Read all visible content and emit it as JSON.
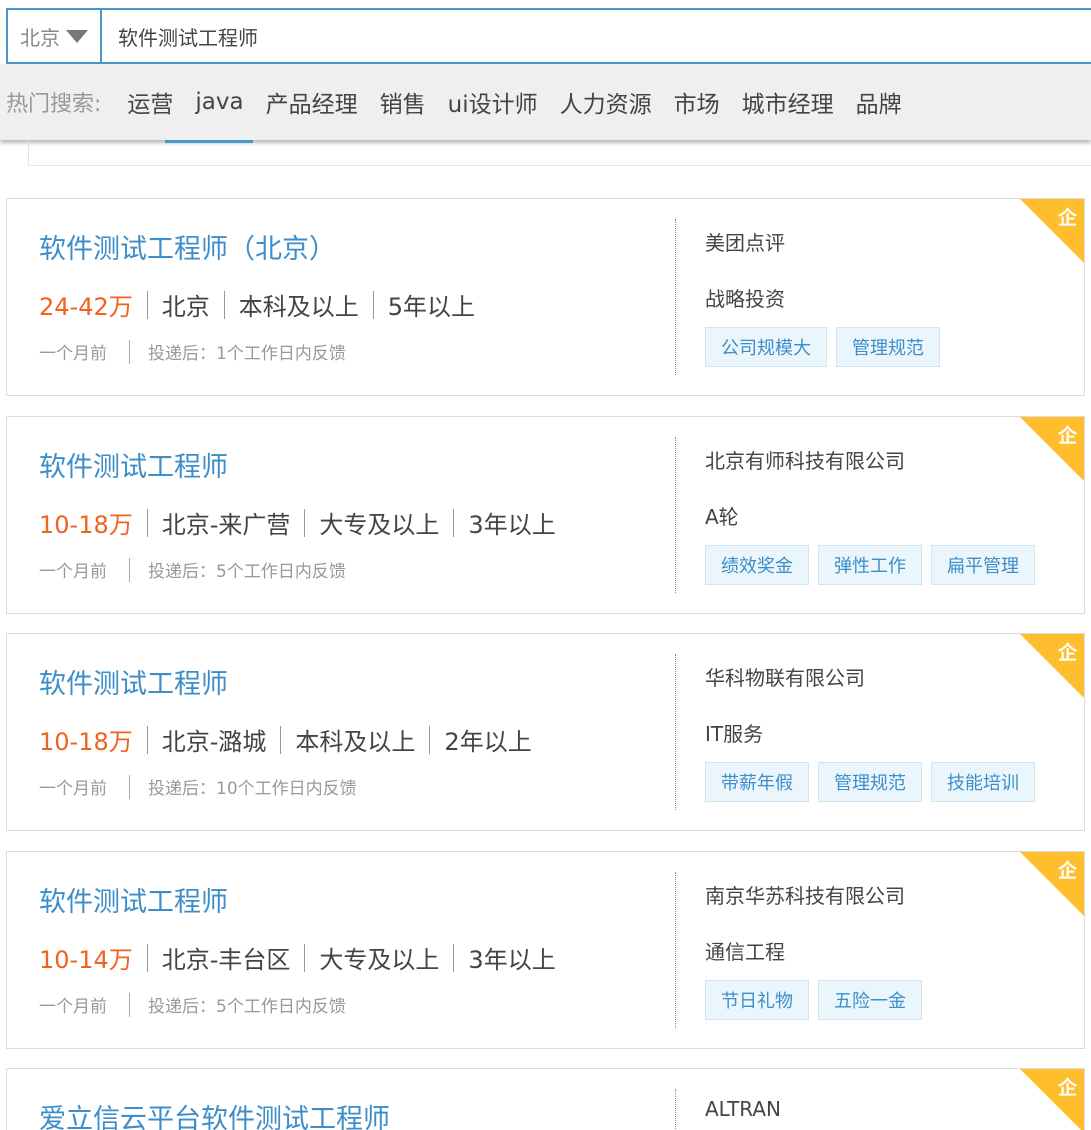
{
  "search": {
    "city": "北京",
    "query": "软件测试工程师"
  },
  "hot_search": {
    "label": "热门搜索:",
    "items": [
      "运营",
      "java",
      "产品经理",
      "销售",
      "ui设计师",
      "人力资源",
      "市场",
      "城市经理",
      "品牌"
    ]
  },
  "jobs": [
    {
      "title": "软件测试工程师（北京）",
      "salary": "24-42万",
      "location": "北京",
      "education": "本科及以上",
      "experience": "5年以上",
      "posted": "一个月前",
      "feedback": "投递后：1个工作日内反馈",
      "company": "美团点评",
      "industry": "战略投资",
      "tags": [
        "公司规模大",
        "管理规范"
      ],
      "badge": "企"
    },
    {
      "title": "软件测试工程师",
      "salary": "10-18万",
      "location": "北京-来广营",
      "education": "大专及以上",
      "experience": "3年以上",
      "posted": "一个月前",
      "feedback": "投递后：5个工作日内反馈",
      "company": "北京有师科技有限公司",
      "industry": "A轮",
      "tags": [
        "绩效奖金",
        "弹性工作",
        "扁平管理"
      ],
      "badge": "企"
    },
    {
      "title": "软件测试工程师",
      "salary": "10-18万",
      "location": "北京-潞城",
      "education": "本科及以上",
      "experience": "2年以上",
      "posted": "一个月前",
      "feedback": "投递后：10个工作日内反馈",
      "company": "华科物联有限公司",
      "industry": "IT服务",
      "tags": [
        "带薪年假",
        "管理规范",
        "技能培训"
      ],
      "badge": "企"
    },
    {
      "title": "软件测试工程师",
      "salary": "10-14万",
      "location": "北京-丰台区",
      "education": "大专及以上",
      "experience": "3年以上",
      "posted": "一个月前",
      "feedback": "投递后：5个工作日内反馈",
      "company": "南京华苏科技有限公司",
      "industry": "通信工程",
      "tags": [
        "节日礼物",
        "五险一金"
      ],
      "badge": "企"
    },
    {
      "title": "爱立信云平台软件测试工程师",
      "company": "ALTRAN",
      "badge": "企"
    }
  ]
}
